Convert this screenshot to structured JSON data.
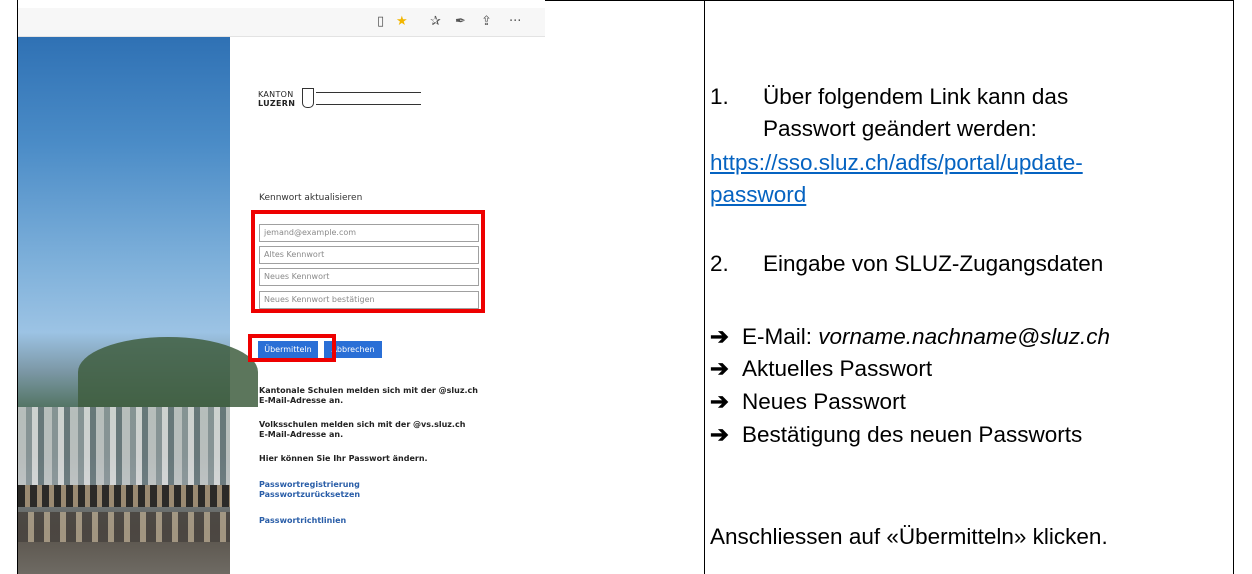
{
  "browser": {
    "icons": [
      "reading-view-icon",
      "star-icon",
      "favorites-icon",
      "pen-icon",
      "share-icon",
      "more-icon"
    ],
    "glyphs": [
      "▯",
      "★",
      "✰",
      "✒",
      "⇪",
      "···"
    ]
  },
  "login": {
    "logo_top": "KANTON",
    "logo_bottom": "LUZERN",
    "title": "Kennwort aktualisieren",
    "fields": [
      {
        "placeholder": "jemand@example.com"
      },
      {
        "placeholder": "Altes Kennwort"
      },
      {
        "placeholder": "Neues Kennwort"
      },
      {
        "placeholder": "Neues Kennwort bestätigen"
      }
    ],
    "submit_label": "Übermitteln",
    "cancel_label": "Abbrechen",
    "note1_line1": "Kantonale Schulen melden sich mit der @sluz.ch",
    "note1_line2": "E-Mail-Adresse an.",
    "note2_line1": "Volksschulen melden sich mit der @vs.sluz.ch",
    "note2_line2": "E-Mail-Adresse an.",
    "note3": "Hier können Sie Ihr Passwort ändern.",
    "link1": "Passwortregistrierung",
    "link2": "Passwortzurücksetzen",
    "link3": "Passwortrichtlinien"
  },
  "instructions": {
    "step1_num": "1.",
    "step1_line1": "Über folgendem Link kann das",
    "step1_line2": "Passwort geändert werden:",
    "url_line1": "https://sso.sluz.ch/adfs/portal/update-",
    "url_line2": "password",
    "step2_num": "2.",
    "step2_text": "Eingabe von SLUZ-Zugangsdaten",
    "arrow": "➔",
    "bullet1_prefix": "E-Mail: ",
    "bullet1_value": "vorname.nachname@sluz.ch",
    "bullet2": "Aktuelles Passwort",
    "bullet3": "Neues Passwort",
    "bullet4": "Bestätigung des neuen Passworts",
    "final": "Anschliessen auf «Übermitteln» klicken."
  },
  "colors": {
    "highlight": "#ee0000",
    "button": "#2a6fd6",
    "link": "#0563c1"
  }
}
